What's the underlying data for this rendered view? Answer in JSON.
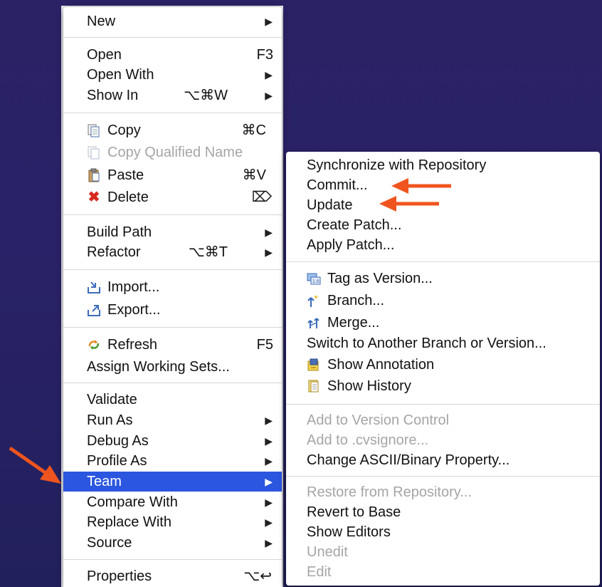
{
  "main_menu": {
    "items": [
      {
        "label": "New",
        "shortcut": "",
        "submenu": true
      },
      {
        "label": "Open",
        "shortcut": "F3",
        "submenu": false
      },
      {
        "label": "Open With",
        "shortcut": "",
        "submenu": true
      },
      {
        "label": "Show In",
        "shortcut": "⌥⌘W",
        "submenu": true
      },
      {
        "label": "Copy",
        "shortcut": "⌘C",
        "icon": "copy-icon"
      },
      {
        "label": "Copy Qualified Name",
        "shortcut": "",
        "icon": "copy-qualified-icon",
        "disabled": true
      },
      {
        "label": "Paste",
        "shortcut": "⌘V",
        "icon": "paste-icon"
      },
      {
        "label": "Delete",
        "shortcut": "⌦",
        "icon": "delete-icon"
      },
      {
        "label": "Build Path",
        "shortcut": "",
        "submenu": true
      },
      {
        "label": "Refactor",
        "shortcut": "⌥⌘T",
        "submenu": true
      },
      {
        "label": "Import...",
        "shortcut": "",
        "icon": "import-icon"
      },
      {
        "label": "Export...",
        "shortcut": "",
        "icon": "export-icon"
      },
      {
        "label": "Refresh",
        "shortcut": "F5",
        "icon": "refresh-icon"
      },
      {
        "label": "Assign Working Sets...",
        "shortcut": ""
      },
      {
        "label": "Validate",
        "shortcut": ""
      },
      {
        "label": "Run As",
        "shortcut": "",
        "submenu": true
      },
      {
        "label": "Debug As",
        "shortcut": "",
        "submenu": true
      },
      {
        "label": "Profile As",
        "shortcut": "",
        "submenu": true
      },
      {
        "label": "Team",
        "shortcut": "",
        "submenu": true,
        "selected": true
      },
      {
        "label": "Compare With",
        "shortcut": "",
        "submenu": true
      },
      {
        "label": "Replace With",
        "shortcut": "",
        "submenu": true
      },
      {
        "label": "Source",
        "shortcut": "",
        "submenu": true
      },
      {
        "label": "Properties",
        "shortcut": "⌥↩"
      }
    ]
  },
  "team_submenu": {
    "items": [
      {
        "label": "Synchronize with Repository"
      },
      {
        "label": "Commit..."
      },
      {
        "label": "Update"
      },
      {
        "label": "Create Patch..."
      },
      {
        "label": "Apply Patch..."
      },
      {
        "label": "Tag as Version...",
        "icon": "tag-icon"
      },
      {
        "label": "Branch...",
        "icon": "branch-icon"
      },
      {
        "label": "Merge...",
        "icon": "merge-icon"
      },
      {
        "label": "Switch to Another Branch or Version..."
      },
      {
        "label": "Show Annotation",
        "icon": "annotation-icon"
      },
      {
        "label": "Show History",
        "icon": "history-icon"
      },
      {
        "label": "Add to Version Control",
        "disabled": true
      },
      {
        "label": "Add to .cvsignore...",
        "disabled": true
      },
      {
        "label": "Change ASCII/Binary Property..."
      },
      {
        "label": "Restore from Repository...",
        "disabled": true
      },
      {
        "label": "Revert to Base"
      },
      {
        "label": "Show Editors"
      },
      {
        "label": "Unedit",
        "disabled": true
      },
      {
        "label": "Edit",
        "disabled": true
      }
    ]
  },
  "colors": {
    "selection": "#2b56e0",
    "annotation_arrow": "#f0541e",
    "background": "#2a2268"
  }
}
